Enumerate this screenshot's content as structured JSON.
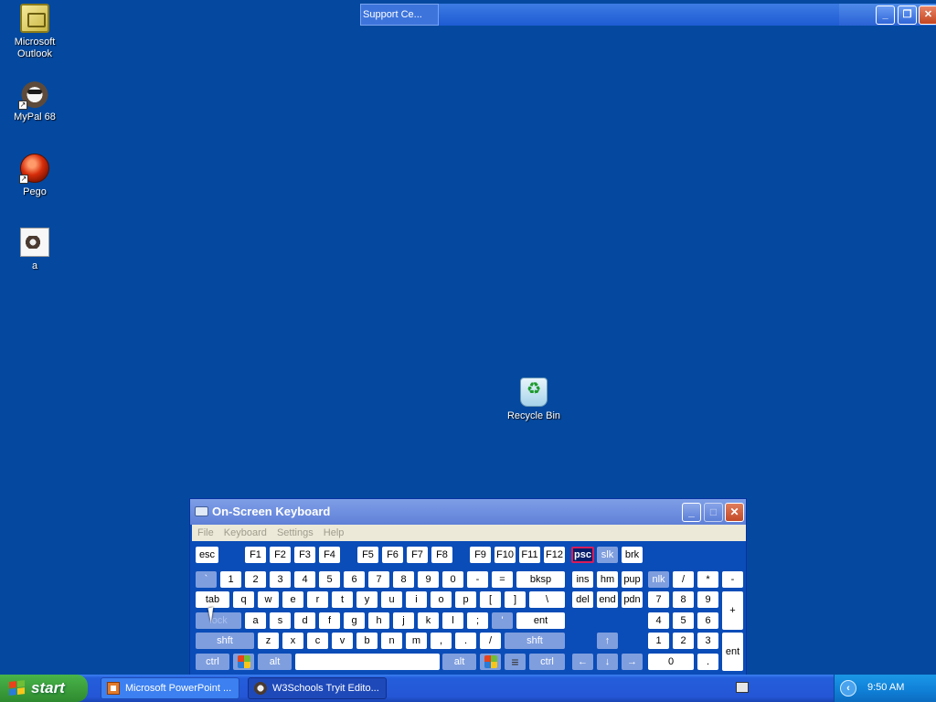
{
  "desktop": {
    "icons": [
      {
        "label_line1": "Microsoft",
        "label_line2": "Outlook"
      },
      {
        "label": "MyPal 68"
      },
      {
        "label": "Pego"
      },
      {
        "label": "a"
      },
      {
        "label": "Recycle Bin"
      }
    ]
  },
  "background_windows": {
    "support_tab": "Support Ce..."
  },
  "osk": {
    "title": "On-Screen Keyboard",
    "menu": [
      "File",
      "Keyboard",
      "Settings",
      "Help"
    ],
    "keys": {
      "esc": "esc",
      "f1": "F1",
      "f2": "F2",
      "f3": "F3",
      "f4": "F4",
      "f5": "F5",
      "f6": "F6",
      "f7": "F7",
      "f8": "F8",
      "f9": "F9",
      "f10": "F10",
      "f11": "F11",
      "f12": "F12",
      "psc": "psc",
      "slk": "slk",
      "brk": "brk",
      "backtick": "`",
      "k1": "1",
      "k2": "2",
      "k3": "3",
      "k4": "4",
      "k5": "5",
      "k6": "6",
      "k7": "7",
      "k8": "8",
      "k9": "9",
      "k0": "0",
      "minus": "-",
      "equals": "=",
      "bksp": "bksp",
      "ins": "ins",
      "hm": "hm",
      "pup": "pup",
      "nlk": "nlk",
      "num_slash": "/",
      "num_star": "*",
      "num_minus": "-",
      "tab": "tab",
      "q": "q",
      "w": "w",
      "e": "e",
      "r": "r",
      "t": "t",
      "y": "y",
      "u": "u",
      "i": "i",
      "o": "o",
      "p": "p",
      "lbracket": "[",
      "rbracket": "]",
      "backslash": "\\",
      "del": "del",
      "end": "end",
      "pdn": "pdn",
      "num7": "7",
      "num8": "8",
      "num9": "9",
      "num_plus": "+",
      "lock": "lock",
      "a": "a",
      "s": "s",
      "d": "d",
      "f": "f",
      "g": "g",
      "h": "h",
      "j": "j",
      "k": "k",
      "l": "l",
      "semicolon": ";",
      "quote": "'",
      "ent": "ent",
      "num4": "4",
      "num5": "5",
      "num6": "6",
      "lshift": "shft",
      "z": "z",
      "x": "x",
      "c": "c",
      "v": "v",
      "b": "b",
      "n": "n",
      "m": "m",
      "comma": ",",
      "period": ".",
      "slash": "/",
      "rshift": "shft",
      "up": "↑",
      "num1": "1",
      "num2": "2",
      "num3": "3",
      "num_ent": "ent",
      "lctrl": "ctrl",
      "lalt": "alt",
      "space": "",
      "ralt": "alt",
      "rctrl": "ctrl",
      "left": "←",
      "down": "↓",
      "right": "→",
      "num0": "0",
      "num_dot": "."
    }
  },
  "taskbar": {
    "start_label": "start",
    "tasks": [
      "Microsoft PowerPoint ...",
      "W3Schools Tryit Edito..."
    ],
    "tray_arrow": "‹",
    "clock": "9:50 AM"
  }
}
